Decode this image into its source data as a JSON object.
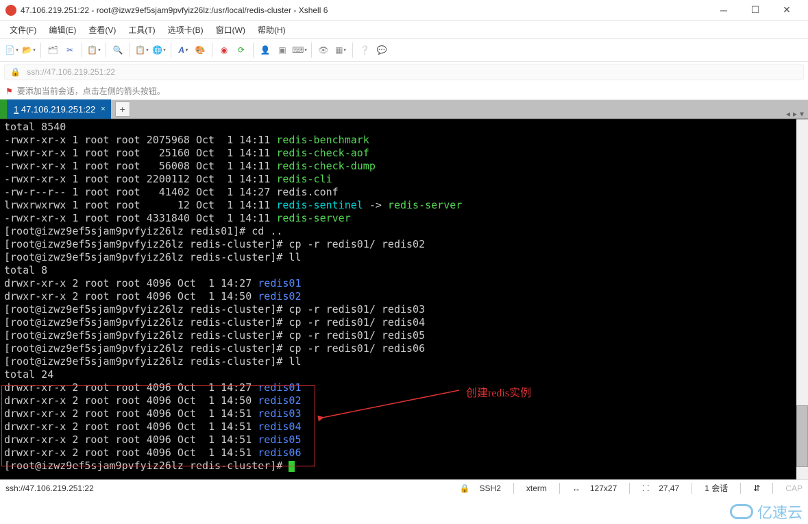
{
  "window": {
    "title": "47.106.219.251:22 - root@izwz9ef5sjam9pvfyiz26lz:/usr/local/redis-cluster - Xshell 6",
    "controls": {
      "min": "─",
      "max": "☐",
      "close": "✕"
    }
  },
  "menu": {
    "file": "文件(F)",
    "edit": "编辑(E)",
    "view": "查看(V)",
    "tools": "工具(T)",
    "tabs": "选项卡(B)",
    "window": "窗口(W)",
    "help": "帮助(H)"
  },
  "toolbar_icons": {
    "new": "📄",
    "open": "📂",
    "tree": "🗂",
    "cut": "✂",
    "copy": "📋",
    "search": "🔍",
    "paste": "📋",
    "globe": "🌐",
    "font": "A",
    "pal": "🎨",
    "red": "◉",
    "refresh": "⟳",
    "person": "👤",
    "term": "▣",
    "code": "⌨",
    "eye": "👁",
    "grid": "▦",
    "help": "❔",
    "chat": "💬"
  },
  "address": {
    "lock": "🔒",
    "url": "ssh://47.106.219.251:22"
  },
  "hint": {
    "flag": "⚑",
    "text": "要添加当前会话，点击左侧的箭头按钮。"
  },
  "tab": {
    "num": "1",
    "label": " 47.106.219.251:22",
    "add": "+"
  },
  "terminal": {
    "total1": "total 8540",
    "ls1": [
      {
        "perm": "-rwxr-xr-x 1 root root 2075968 Oct  1 14:11 ",
        "name": "redis-benchmark"
      },
      {
        "perm": "-rwxr-xr-x 1 root root   25160 Oct  1 14:11 ",
        "name": "redis-check-aof"
      },
      {
        "perm": "-rwxr-xr-x 1 root root   56008 Oct  1 14:11 ",
        "name": "redis-check-dump"
      },
      {
        "perm": "-rwxr-xr-x 1 root root 2200112 Oct  1 14:11 ",
        "name": "redis-cli"
      },
      {
        "perm": "-rw-r--r-- 1 root root   41402 Oct  1 14:27 redis.conf",
        "name": ""
      },
      {
        "perm": "lrwxrwxrwx 1 root root      12 Oct  1 14:11 ",
        "name": "redis-sentinel",
        "arrow": " -> ",
        "target": "redis-server"
      },
      {
        "perm": "-rwxr-xr-x 1 root root 4331840 Oct  1 14:11 ",
        "name": "redis-server"
      }
    ],
    "p1_pre": "[root@izwz9ef5sjam9pvfyiz26lz redis01]# ",
    "p1_cmd": "cd ..",
    "p2_pre": "[root@izwz9ef5sjam9pvfyiz26lz redis-cluster]# ",
    "p2_cmd": "cp -r redis01/ redis02",
    "p3_cmd": "ll",
    "total2": "total 8",
    "ls2": [
      {
        "perm": "drwxr-xr-x 2 root root 4096 Oct  1 14:27 ",
        "name": "redis01"
      },
      {
        "perm": "drwxr-xr-x 2 root root 4096 Oct  1 14:50 ",
        "name": "redis02"
      }
    ],
    "cp3": "cp -r redis01/ redis03",
    "cp4": "cp -r redis01/ redis04",
    "cp5": "cp -r redis01/ redis05",
    "cp6": "cp -r redis01/ redis06",
    "total3": "total 24",
    "ls3": [
      {
        "perm": "drwxr-xr-x 2 root root 4096 Oct  1 14:27 ",
        "name": "redis01"
      },
      {
        "perm": "drwxr-xr-x 2 root root 4096 Oct  1 14:50 ",
        "name": "redis02"
      },
      {
        "perm": "drwxr-xr-x 2 root root 4096 Oct  1 14:51 ",
        "name": "redis03"
      },
      {
        "perm": "drwxr-xr-x 2 root root 4096 Oct  1 14:51 ",
        "name": "redis04"
      },
      {
        "perm": "drwxr-xr-x 2 root root 4096 Oct  1 14:51 ",
        "name": "redis05"
      },
      {
        "perm": "drwxr-xr-x 2 root root 4096 Oct  1 14:51 ",
        "name": "redis06"
      }
    ],
    "annotation": "创建redis实例"
  },
  "status": {
    "left": "ssh://47.106.219.251:22",
    "lock": "🔒",
    "ssh": "SSH2",
    "term": "xterm",
    "size": "�közi 127x27",
    "pos_icon": "⸬",
    "pos": "27,47",
    "sess": "1 会话",
    "net": "⇵",
    "cap": "CA"
  },
  "sizefix": {
    "size": "127x27"
  },
  "watermark": "亿速云"
}
